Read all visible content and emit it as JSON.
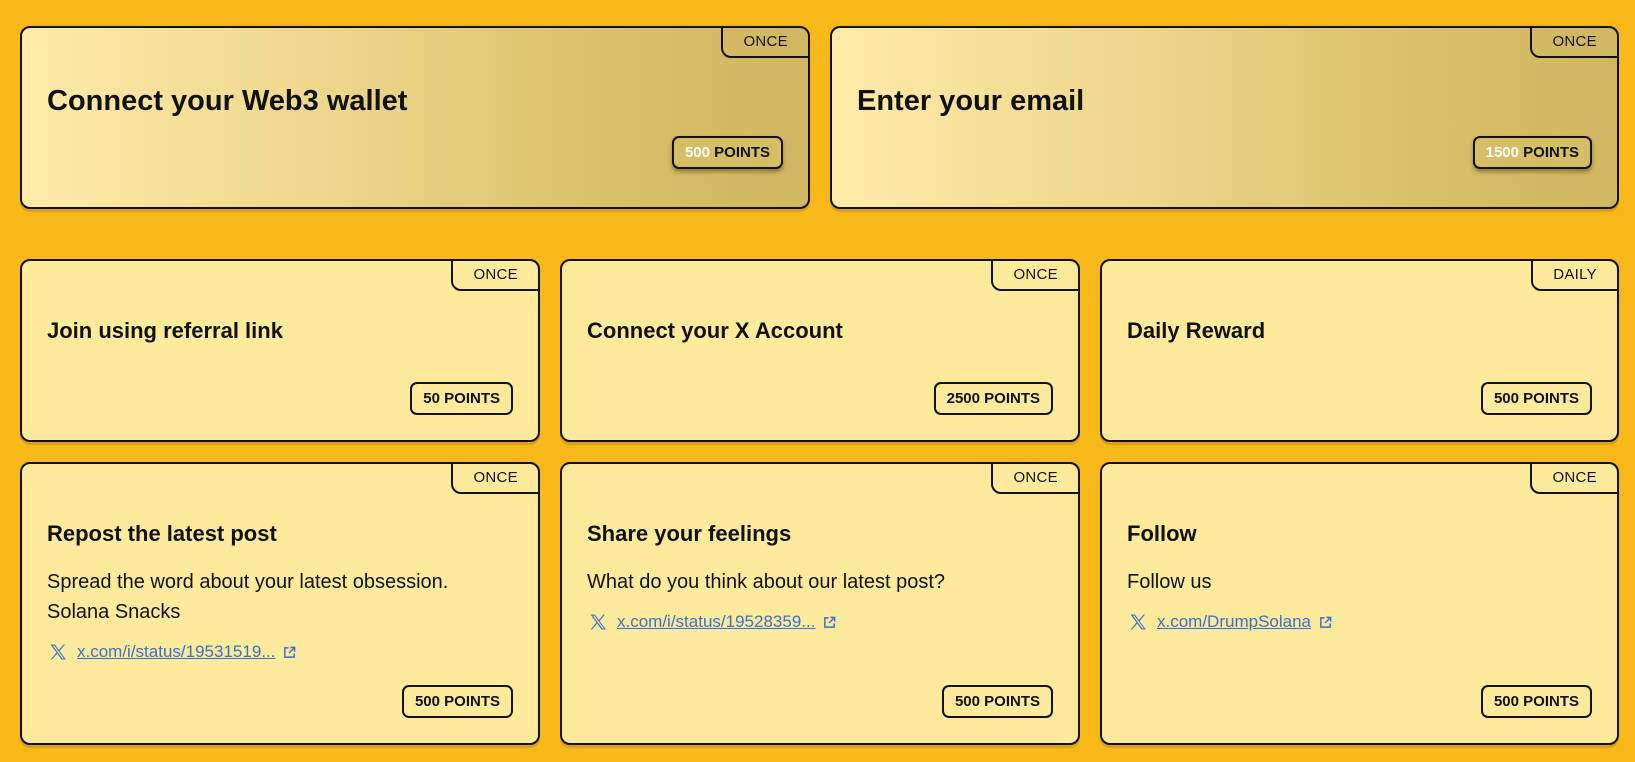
{
  "top_cards": [
    {
      "title": "Connect your Web3 wallet",
      "frequency": "ONCE",
      "points_value": "500",
      "points_label": "POINTS"
    },
    {
      "title": "Enter your email",
      "frequency": "ONCE",
      "points_value": "1500",
      "points_label": "POINTS"
    }
  ],
  "cards": [
    {
      "title": "Join using referral link",
      "frequency": "ONCE",
      "points": "50 POINTS"
    },
    {
      "title": "Connect your X Account",
      "frequency": "ONCE",
      "points": "2500 POINTS"
    },
    {
      "title": "Daily Reward",
      "frequency": "DAILY",
      "points": "500 POINTS"
    },
    {
      "title": "Repost the latest post",
      "frequency": "ONCE",
      "description": "Spread the word about your latest obsession. Solana Snacks",
      "link": "x.com/i/status/19531519...",
      "points": "500 POINTS"
    },
    {
      "title": "Share your feelings",
      "frequency": "ONCE",
      "description": "What do you think about our latest post?",
      "link": "x.com/i/status/19528359...",
      "points": "500 POINTS"
    },
    {
      "title": "Follow",
      "frequency": "ONCE",
      "description": "Follow us",
      "link": "x.com/DrumpSolana",
      "points": "500 POINTS"
    }
  ],
  "icons": {
    "link_brand": "x-logo-icon",
    "link_external": "external-link-icon"
  },
  "colors": {
    "background": "#f8b81a",
    "card": "#feea9b",
    "link": "#3a6fd0"
  }
}
